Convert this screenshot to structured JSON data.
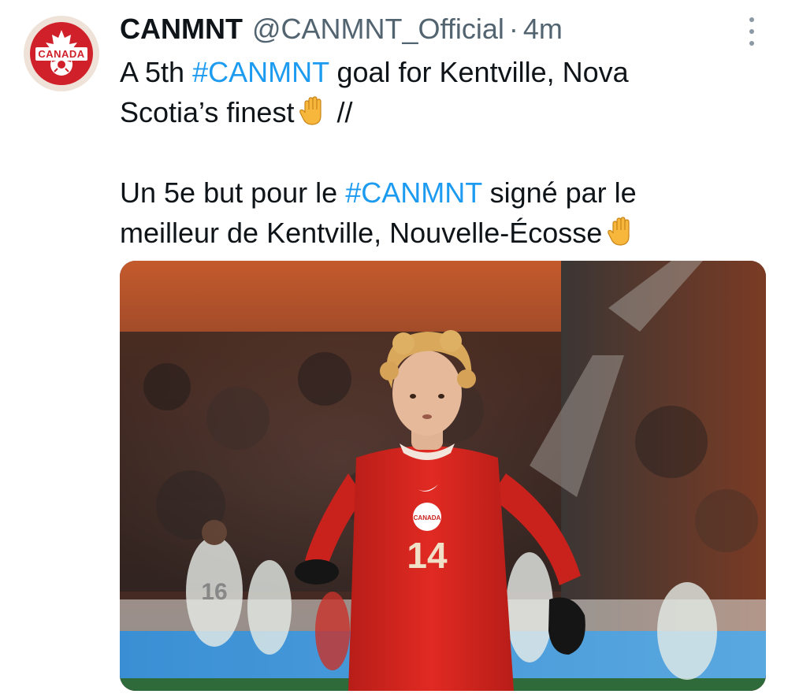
{
  "tweet": {
    "author_name": "CANMNT",
    "author_handle": "@CANMNT_Official",
    "separator": "·",
    "timestamp": "4m",
    "avatar_text": "CANADA",
    "lines": {
      "l1_a": "A 5th ",
      "l1_tag": "#CANMNT",
      "l1_b": " goal for Kentville, Nova",
      "l2_a": "Scotia’s finest",
      "l2_b": " //",
      "l3_a": "Un 5e but pour le ",
      "l3_tag": "#CANMNT",
      "l3_b": " signé par le",
      "l4_a": "meilleur de Kentville, Nouvelle-Écosse"
    },
    "emoji": "raised-hand-emoji",
    "media": {
      "jersey_number": "14",
      "crest_text": "CANADA",
      "background_number": "16"
    }
  },
  "colors": {
    "hashtag": "#1d9bf0",
    "text": "#0f1419",
    "secondary": "#536471",
    "jersey_red": "#d8261f"
  }
}
